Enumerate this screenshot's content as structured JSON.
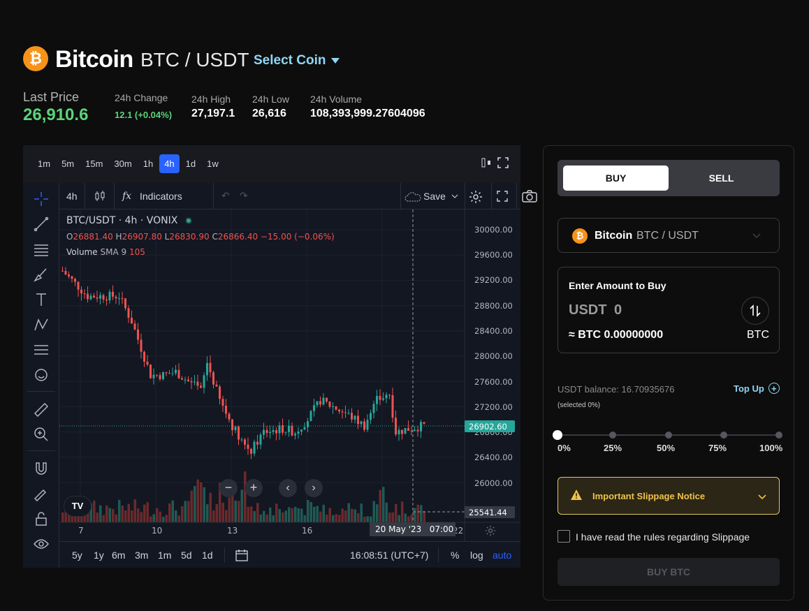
{
  "header": {
    "coin_symbol_glyph": "₿",
    "coin_name": "Bitcoin",
    "pair": "BTC / USDT",
    "select_coin": "Select Coin"
  },
  "stats": {
    "last_price_label": "Last Price",
    "last_price": "26,910.6",
    "change_label": "24h Change",
    "change": "12.1 (+0.04%)",
    "high_label": "24h High",
    "high": "27,197.1",
    "low_label": "24h Low",
    "low": "26,616",
    "volume_label": "24h Volume",
    "volume": "108,393,999.27604096"
  },
  "colors": {
    "accent": "#8fd7f5",
    "up": "#26a69a",
    "down": "#ef5350",
    "price_green": "#5bd47a",
    "btc_orange": "#f7931a",
    "tv_blue": "#2962ff"
  },
  "chart": {
    "timeframes": [
      "1m",
      "5m",
      "15m",
      "30m",
      "1h",
      "4h",
      "1d",
      "1w"
    ],
    "active_timeframe": "4h",
    "toolbar": {
      "interval": "4h",
      "indicators": "Indicators",
      "save": "Save"
    },
    "legend": {
      "symbol": "BTC/USDT · 4h · VONIX",
      "o_label": "O",
      "o": "26881.40",
      "h_label": "H",
      "h": "26907.80",
      "l_label": "L",
      "l": "26830.90",
      "c_label": "C",
      "c": "26866.40",
      "chg": "−15.00 (−0.06%)",
      "volume_label": "Volume",
      "sma_label": "SMA 9",
      "volume_value": "105"
    },
    "price_axis": [
      "30000.00",
      "29600.00",
      "29200.00",
      "28800.00",
      "28400.00",
      "28000.00",
      "27600.00",
      "27200.00",
      "26800.00",
      "26400.00",
      "26000.00"
    ],
    "current_price_tag": "26902.60",
    "crosshair_price_tag": "25541.44",
    "time_axis": [
      "7",
      "10",
      "13",
      "16",
      "22"
    ],
    "crosshair_time_tag": "20 May '23   07:00",
    "bottom": {
      "ranges": [
        "5y",
        "1y",
        "6m",
        "3m",
        "1m",
        "5d",
        "1d"
      ],
      "clock": "16:08:51 (UTC+7)",
      "percent": "%",
      "log": "log",
      "auto": "auto"
    },
    "logo_text": "TV"
  },
  "trade": {
    "buy_tab": "BUY",
    "sell_tab": "SELL",
    "asset_name": "Bitcoin",
    "asset_pair": "BTC / USDT",
    "enter_amount_label": "Enter Amount to Buy",
    "amount_currency": "USDT",
    "amount_value": "0",
    "conversion": "≈ BTC 0.00000000",
    "target_currency": "BTC",
    "balance": "USDT balance: 16.70935676",
    "top_up": "Top Up",
    "selected": "(selected 0%)",
    "slider_percent": 0,
    "slider_marks": [
      "0%",
      "25%",
      "50%",
      "75%",
      "100%"
    ],
    "notice": "Important Slippage Notice",
    "checkbox_label": "I have read the rules regarding Slippage",
    "buy_button": "BUY BTC"
  }
}
